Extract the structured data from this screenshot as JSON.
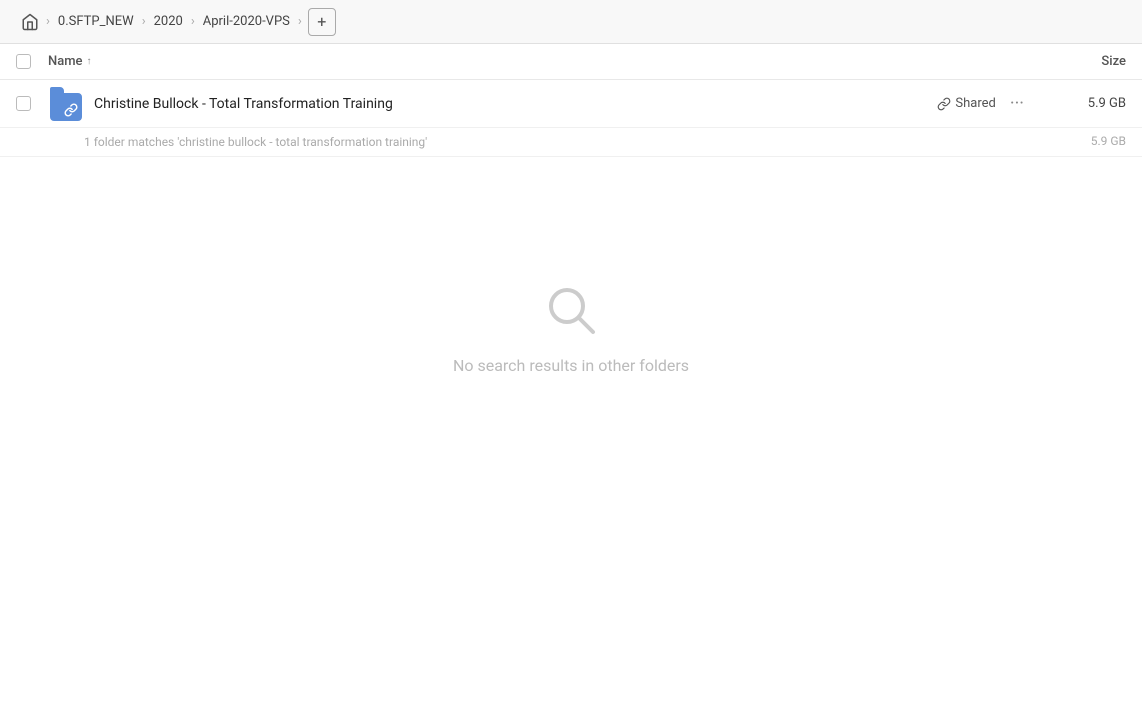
{
  "breadcrumb": {
    "home_icon": "home",
    "items": [
      {
        "label": "0.SFTP_NEW"
      },
      {
        "label": "2020"
      },
      {
        "label": "April-2020-VPS"
      }
    ],
    "add_label": "+"
  },
  "table": {
    "col_name": "Name",
    "col_size": "Size",
    "sort_indicator": "↑"
  },
  "file_row": {
    "name": "Christine Bullock - Total Transformation Training",
    "shared_label": "Shared",
    "size": "5.9 GB",
    "match_text": "1 folder matches 'christine bullock - total transformation training'",
    "match_size": "5.9 GB"
  },
  "empty_state": {
    "message": "No search results in other folders"
  }
}
